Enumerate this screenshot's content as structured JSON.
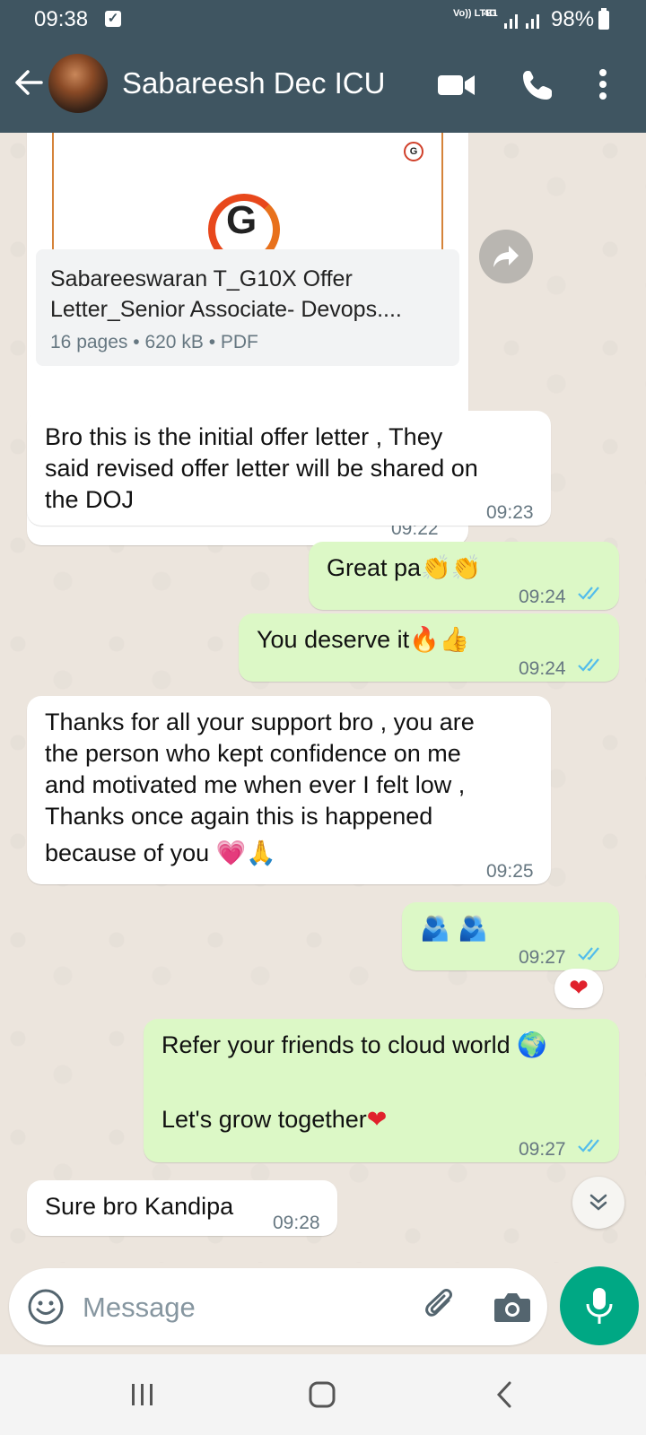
{
  "status_bar": {
    "time": "09:38",
    "network": "Vo)) LTE1",
    "signal": "4G",
    "battery": "98%"
  },
  "header": {
    "contact_name": "Sabareesh Dec ICU"
  },
  "messages": {
    "doc": {
      "logo_letter": "G",
      "title_line1": "Sabareeswaran T_G10X Offer",
      "title_line2": "Letter_Senior Associate- Devops....",
      "pages": "16 pages",
      "size": "620 kB",
      "type": "PDF",
      "time": "09:22"
    },
    "m1": {
      "line1": "Bro this is the initial offer letter , They",
      "line2": "said revised offer letter will be shared on",
      "line3": "the DOJ",
      "time": "09:23"
    },
    "m2": {
      "text": "Great pa",
      "emoji": "👏👏",
      "time": "09:24"
    },
    "m3": {
      "text": "You deserve it",
      "emoji": "🔥👍",
      "time": "09:24"
    },
    "m4": {
      "line1": "Thanks for all your support bro , you are",
      "line2": "the person who kept confidence on me",
      "line3": "and motivated me when ever I felt low ,",
      "line4": "Thanks once again this is happened",
      "line5": "because of you",
      "emoji": "💗🙏",
      "time": "09:25"
    },
    "m5": {
      "emoji": "🫂 🫂",
      "time": "09:27",
      "reaction": "❤"
    },
    "m6": {
      "line1": "Refer your friends to cloud world",
      "emoji1": "🌍",
      "line2": "Let's grow together",
      "emoji2": "❤",
      "time": "09:27"
    },
    "m7": {
      "text": "Sure bro Kandipa",
      "time": "09:28"
    }
  },
  "composer": {
    "placeholder": "Message"
  },
  "colors": {
    "header": "#3f5561",
    "incoming": "#ffffff",
    "outgoing": "#dcf8c6",
    "accent": "#00a884",
    "read_ticks": "#53bdeb"
  },
  "icons": [
    "back-arrow-icon",
    "video-call-icon",
    "voice-call-icon",
    "more-options-icon",
    "forward-icon",
    "double-check-icon",
    "chevron-down-double-icon",
    "emoji-icon",
    "paperclip-icon",
    "camera-icon",
    "microphone-icon",
    "nav-recent-icon",
    "nav-home-icon",
    "nav-back-icon"
  ]
}
